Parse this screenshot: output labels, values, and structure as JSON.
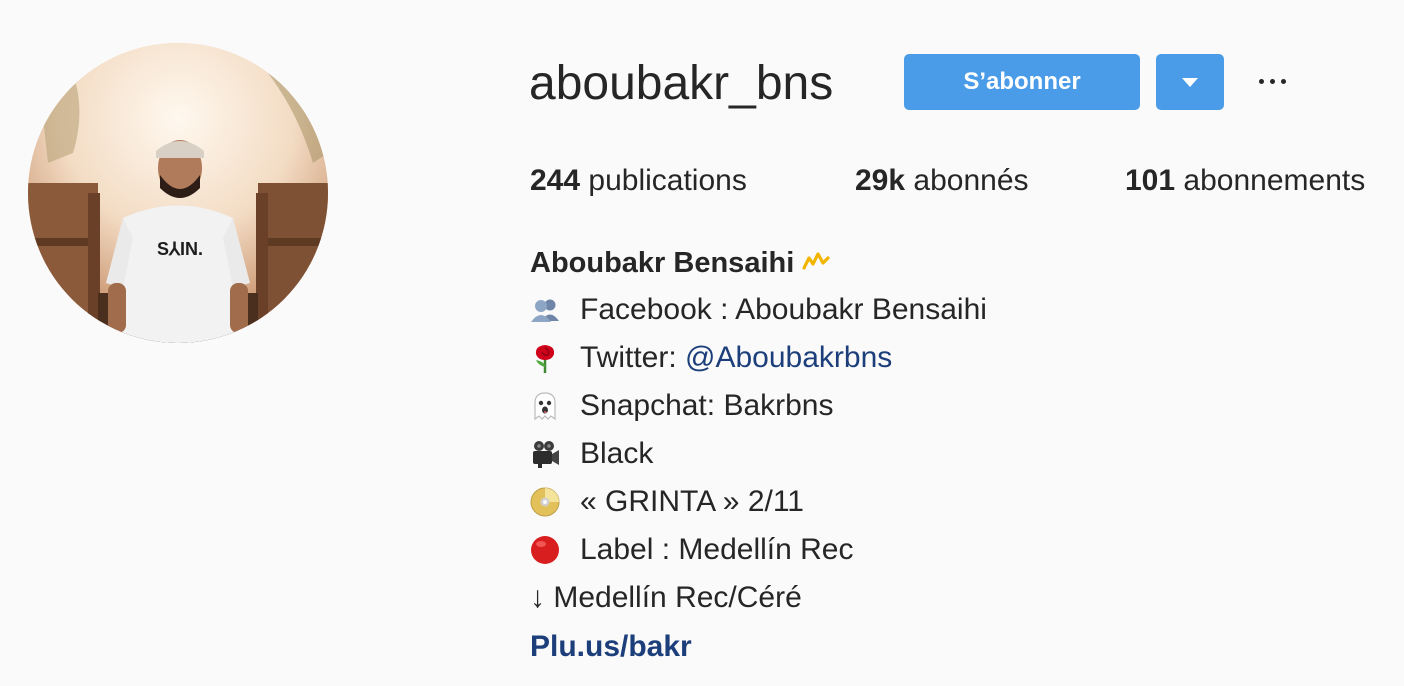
{
  "profile": {
    "username": "aboubakr_bns",
    "follow_label": "S’abonner",
    "stats": {
      "posts_count": "244",
      "posts_label": "publications",
      "followers_count": "29k",
      "followers_label": "abonnés",
      "following_count": "101",
      "following_label": "abonnements"
    },
    "full_name": "Aboubakr Bensaihi",
    "name_emoji": "〽️",
    "bio": [
      {
        "icon": "busts-icon",
        "text": "Facebook : Aboubakr Bensaihi"
      },
      {
        "icon": "rose-icon",
        "text_prefix": "Twitter: ",
        "mention": "@Aboubakrbns"
      },
      {
        "icon": "ghost-icon",
        "text": "Snapchat: Bakrbns"
      },
      {
        "icon": "movie-camera-icon",
        "text": "Black"
      },
      {
        "icon": "dvd-icon",
        "text": "« GRINTA » 2/11"
      },
      {
        "icon": "red-circle-icon",
        "text": "Label : Medellín Rec"
      },
      {
        "text": "↓ Medellín Rec/Céré"
      }
    ],
    "website": "Plu.us/bakr"
  },
  "colors": {
    "primary_button": "#4a9ce8",
    "link": "#1c3e7a",
    "text": "#262626",
    "background": "#fafafa"
  }
}
